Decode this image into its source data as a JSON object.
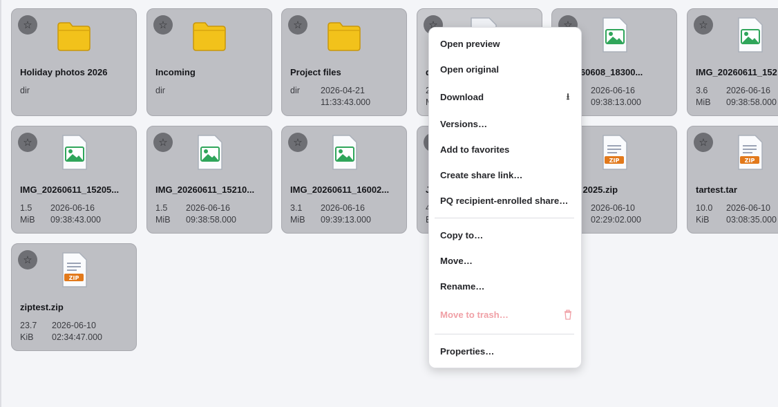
{
  "tiles": [
    {
      "name": "Holiday photos 2026",
      "type": "folder",
      "size": "dir",
      "date": "",
      "time": ""
    },
    {
      "name": "Incoming",
      "type": "folder",
      "size": "dir",
      "date": "",
      "time": ""
    },
    {
      "name": "Project files",
      "type": "folder",
      "size": "dir",
      "date": "2026-04-21",
      "time": "11:33:43.000"
    },
    {
      "name": "d",
      "type": "file",
      "size": "2",
      "date": "",
      "time": "",
      "size2": "M"
    },
    {
      "name": "_20260608_18300...",
      "type": "image",
      "size": "",
      "date": "2026-06-16",
      "time": "09:38:13.000"
    },
    {
      "name": "IMG_20260611_152",
      "type": "image",
      "size": "3.6",
      "size2": "MiB",
      "date": "2026-06-16",
      "time": "09:38:58.000"
    },
    {
      "name": "IMG_20260611_15205...",
      "type": "image",
      "size": "1.5",
      "size2": "MiB",
      "date": "2026-06-16",
      "time": "09:38:43.000"
    },
    {
      "name": "IMG_20260611_15210...",
      "type": "image",
      "size": "1.5",
      "size2": "MiB",
      "date": "2026-06-16",
      "time": "09:38:58.000"
    },
    {
      "name": "IMG_20260611_16002...",
      "type": "image",
      "size": "3.1",
      "size2": "MiB",
      "date": "2026-06-16",
      "time": "09:39:13.000"
    },
    {
      "name": "J",
      "type": "file",
      "size": "4",
      "size2": "E",
      "date": "",
      "time": ""
    },
    {
      "name": "K   ntl 2025.zip",
      "type": "zip",
      "size": "",
      "date": "2026-06-10",
      "time": "02:29:02.000"
    },
    {
      "name": "tartest.tar",
      "type": "zip",
      "size": "10.0",
      "size2": "KiB",
      "date": "2026-06-10",
      "time": "03:08:35.000"
    },
    {
      "name": "ziptest.zip",
      "type": "zip",
      "size": "23.7",
      "size2": "KiB",
      "date": "2026-06-10",
      "time": "02:34:47.000"
    }
  ],
  "icons": {
    "star": "star-icon",
    "folder": "folder-icon",
    "image": "image-file-icon",
    "zip": "zip-file-icon",
    "download": "download-icon",
    "trash": "trash-icon"
  },
  "zip_badge": "ZIP",
  "star_glyph": "☆",
  "menu": {
    "open_preview": "Open preview",
    "open_original": "Open original",
    "download": "Download",
    "download_glyph": "⭳",
    "versions": "Versions…",
    "add_favorites": "Add to favorites",
    "create_share": "Create share link…",
    "pq_share": "PQ recipient-enrolled share…",
    "copy_to": "Copy to…",
    "move": "Move…",
    "rename": "Rename…",
    "move_trash": "Move to trash…",
    "properties": "Properties…"
  },
  "colors": {
    "accent_folder": "#f5c518",
    "trash_disabled": "#f0a0a6",
    "image_green": "#2fa55a",
    "zip_orange": "#e2791b"
  }
}
